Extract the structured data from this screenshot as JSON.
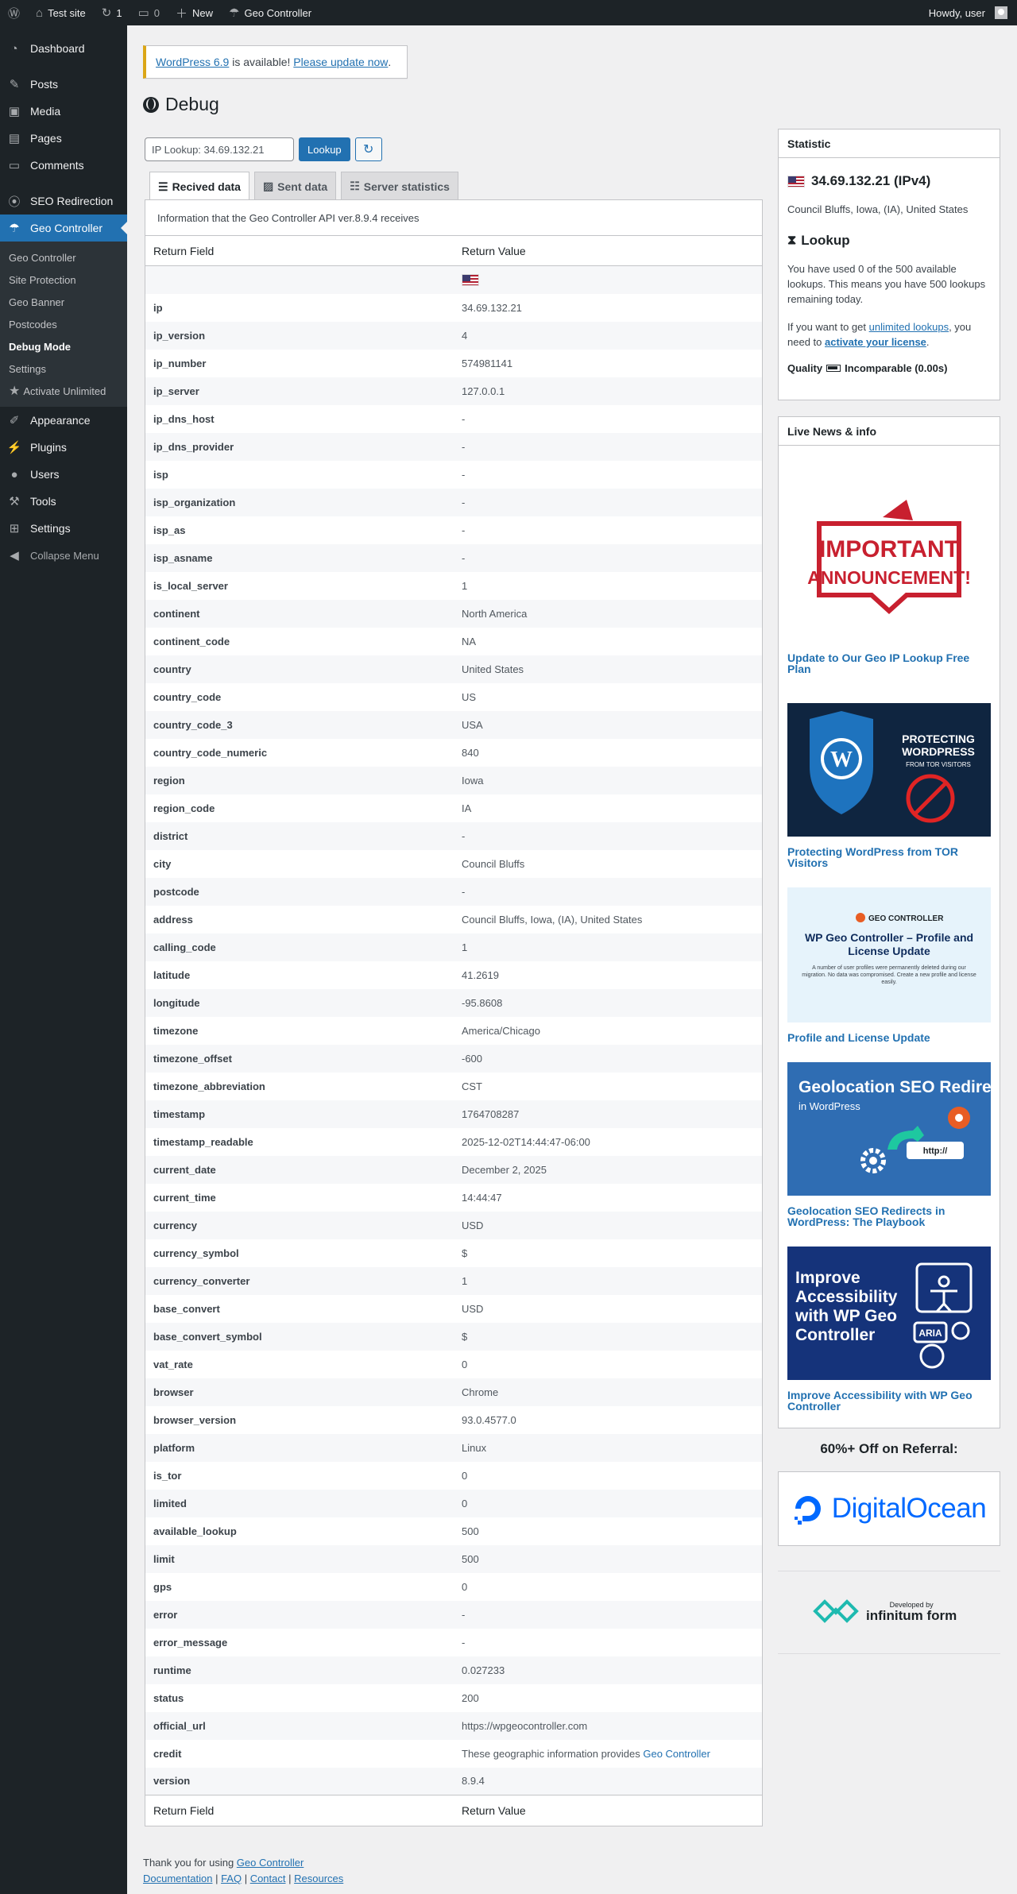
{
  "adminbar": {
    "site_name": "Test site",
    "updates_count": "1",
    "comments_count": "0",
    "new_label": "New",
    "plugin_label": "Geo Controller",
    "howdy": "Howdy, user"
  },
  "sidebar": {
    "items": [
      {
        "label": "Dashboard",
        "icon": "dashboard-icon"
      },
      {
        "label": "Posts",
        "icon": "pin-icon"
      },
      {
        "label": "Media",
        "icon": "media-icon"
      },
      {
        "label": "Pages",
        "icon": "pages-icon"
      },
      {
        "label": "Comments",
        "icon": "comment-icon"
      },
      {
        "label": "SEO Redirection",
        "icon": "location-icon"
      },
      {
        "label": "Geo Controller",
        "icon": "globe-icon"
      }
    ],
    "submenu": [
      "Geo Controller",
      "Site Protection",
      "Geo Banner",
      "Postcodes",
      "Debug Mode",
      "Settings",
      "Activate Unlimited"
    ],
    "lower_items": [
      {
        "label": "Appearance",
        "icon": "brush-icon"
      },
      {
        "label": "Plugins",
        "icon": "plug-icon"
      },
      {
        "label": "Users",
        "icon": "user-icon"
      },
      {
        "label": "Tools",
        "icon": "wrench-icon"
      },
      {
        "label": "Settings",
        "icon": "settings-icon"
      }
    ],
    "collapse": "Collapse Menu"
  },
  "notice": {
    "link1": "WordPress 6.9",
    "text": " is available! ",
    "link2": "Please update now",
    "end": "."
  },
  "page_title": "Debug",
  "lookup": {
    "value": "IP Lookup: 34.69.132.21",
    "button": "Lookup"
  },
  "tabs": [
    "Recived data",
    "Sent data",
    "Server statistics"
  ],
  "api_info": "Information that the Geo Controller API ver.8.9.4 receives",
  "table": {
    "col_field": "Return Field",
    "col_value": "Return Value",
    "rows": [
      [
        "ip",
        "34.69.132.21"
      ],
      [
        "ip_version",
        "4"
      ],
      [
        "ip_number",
        "574981141"
      ],
      [
        "ip_server",
        "127.0.0.1"
      ],
      [
        "ip_dns_host",
        "-"
      ],
      [
        "ip_dns_provider",
        "-"
      ],
      [
        "isp",
        "-"
      ],
      [
        "isp_organization",
        "-"
      ],
      [
        "isp_as",
        "-"
      ],
      [
        "isp_asname",
        "-"
      ],
      [
        "is_local_server",
        "1"
      ],
      [
        "continent",
        "North America"
      ],
      [
        "continent_code",
        "NA"
      ],
      [
        "country",
        "United States"
      ],
      [
        "country_code",
        "US"
      ],
      [
        "country_code_3",
        "USA"
      ],
      [
        "country_code_numeric",
        "840"
      ],
      [
        "region",
        "Iowa"
      ],
      [
        "region_code",
        "IA"
      ],
      [
        "district",
        "-"
      ],
      [
        "city",
        "Council Bluffs"
      ],
      [
        "postcode",
        "-"
      ],
      [
        "address",
        "Council Bluffs, Iowa, (IA), United States"
      ],
      [
        "calling_code",
        "1"
      ],
      [
        "latitude",
        "41.2619"
      ],
      [
        "longitude",
        "-95.8608"
      ],
      [
        "timezone",
        "America/Chicago"
      ],
      [
        "timezone_offset",
        "-600"
      ],
      [
        "timezone_abbreviation",
        "CST"
      ],
      [
        "timestamp",
        "1764708287"
      ],
      [
        "timestamp_readable",
        "2025-12-02T14:44:47-06:00"
      ],
      [
        "current_date",
        "December 2, 2025"
      ],
      [
        "current_time",
        "14:44:47"
      ],
      [
        "currency",
        "USD"
      ],
      [
        "currency_symbol",
        "$"
      ],
      [
        "currency_converter",
        "1"
      ],
      [
        "base_convert",
        "USD"
      ],
      [
        "base_convert_symbol",
        "$"
      ],
      [
        "vat_rate",
        "0"
      ],
      [
        "browser",
        "Chrome"
      ],
      [
        "browser_version",
        "93.0.4577.0"
      ],
      [
        "platform",
        "Linux"
      ],
      [
        "is_tor",
        "0"
      ],
      [
        "limited",
        "0"
      ],
      [
        "available_lookup",
        "500"
      ],
      [
        "limit",
        "500"
      ],
      [
        "gps",
        "0"
      ],
      [
        "error",
        "-"
      ],
      [
        "error_message",
        "-"
      ],
      [
        "runtime",
        "0.027233"
      ],
      [
        "status",
        "200"
      ],
      [
        "official_url",
        "https://wpgeocontroller.com"
      ],
      [
        "credit",
        "These geographic information provides "
      ],
      [
        "version",
        "8.9.4"
      ]
    ],
    "credit_link": "Geo Controller"
  },
  "statistic": {
    "title": "Statistic",
    "ip": "34.69.132.21 (IPv4)",
    "location": "Council Bluffs, Iowa, (IA), United States",
    "lookup_heading": "Lookup",
    "lookup_text": "You have used 0 of the 500 available lookups. This means you have 500 lookups remaining today.",
    "unlimited_pre": "If you want to get ",
    "unlimited_link": "unlimited lookups",
    "unlimited_mid": ", you need to ",
    "activate_link": "activate your license",
    "unlimited_end": ".",
    "quality_label": "Quality",
    "quality_value": "Incomparable (0.00s)"
  },
  "news": {
    "title": "Live News & info",
    "items": [
      {
        "title": "Update to Our Geo IP Lookup Free Plan",
        "img_text": [
          "IMPORTANT",
          "ANNOUNCEMENT!"
        ]
      },
      {
        "title": "Protecting WordPress from TOR Visitors",
        "img_text": [
          "PROTECTING",
          "WORDPRESS",
          "FROM TOR VISITORS"
        ]
      },
      {
        "title": "Profile and License Update",
        "img_text": [
          "GEO CONTROLLER",
          "WP Geo Controller – Profile and License Update",
          "A number of user profiles were permanently deleted during our migration. No data was compromised. Create a new profile and license easily."
        ]
      },
      {
        "title": "Geolocation SEO Redirects in WordPress: The Playbook",
        "img_text": [
          "Geolocation SEO Redirects",
          "in WordPress",
          "http://"
        ]
      },
      {
        "title": "Improve Accessibility with WP Geo Controller",
        "img_text": [
          "Improve Accessibility with WP Geo Controller",
          "ARIA"
        ]
      }
    ]
  },
  "referral": {
    "title": "60%+ Off on Referral:",
    "brand": "DigitalOcean"
  },
  "developed_by": {
    "top": "Developed by",
    "brand": "infinitum form"
  },
  "footer": {
    "thanks": "Thank you for using ",
    "thanks_link": "Geo Controller",
    "links": [
      "Documentation",
      "FAQ",
      "Contact",
      "Resources"
    ]
  },
  "colors": {
    "accent": "#2271b1",
    "sidebar": "#1d2327",
    "notice_border": "#dba617"
  }
}
